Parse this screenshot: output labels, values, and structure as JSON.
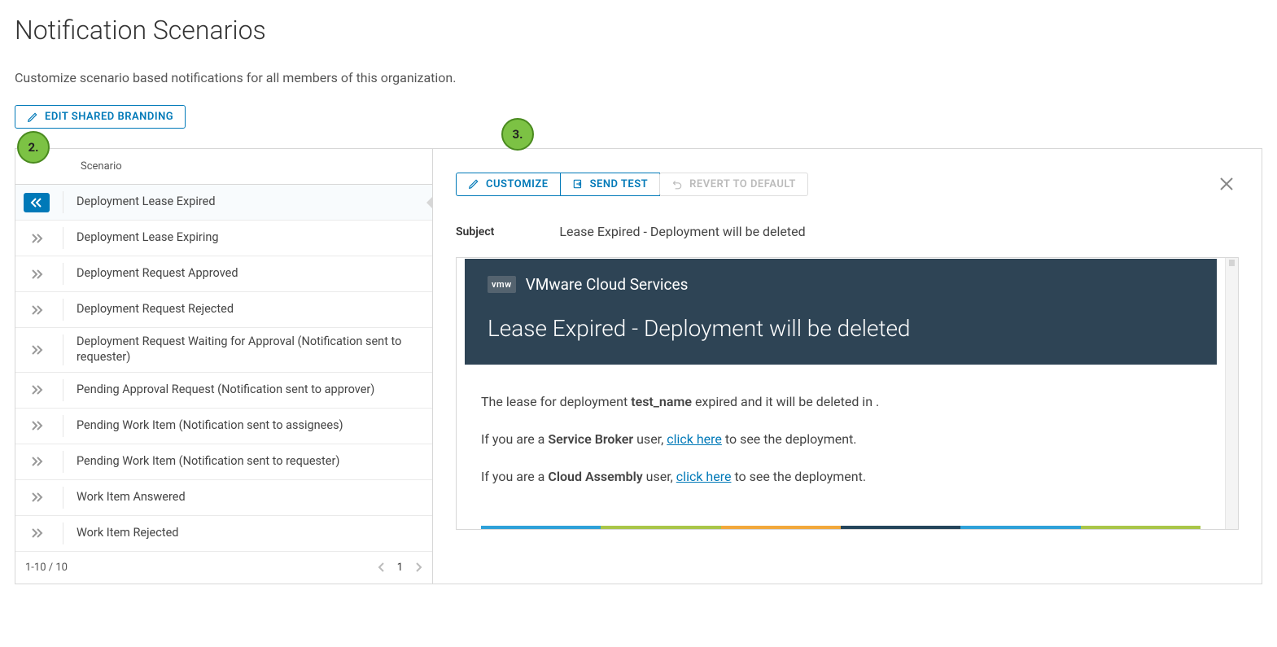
{
  "page": {
    "title": "Notification Scenarios",
    "subtitle": "Customize scenario based notifications for all members of this organization.",
    "edit_branding": "EDIT SHARED BRANDING"
  },
  "callouts": {
    "c2": "2.",
    "c3": "3."
  },
  "scenario_header": "Scenario",
  "scenarios": [
    {
      "label": "Deployment Lease Expired",
      "selected": true
    },
    {
      "label": "Deployment Lease Expiring"
    },
    {
      "label": "Deployment Request Approved"
    },
    {
      "label": "Deployment Request Rejected"
    },
    {
      "label": "Deployment Request Waiting for Approval (Notification sent to requester)"
    },
    {
      "label": "Pending Approval Request (Notification sent to approver)"
    },
    {
      "label": "Pending Work Item (Notification sent to assignees)"
    },
    {
      "label": "Pending Work Item (Notification sent to requester)"
    },
    {
      "label": "Work Item Answered"
    },
    {
      "label": "Work Item Rejected"
    }
  ],
  "pagination": {
    "range": "1-10 / 10",
    "page": "1"
  },
  "detail": {
    "customize": "CUSTOMIZE",
    "send_test": "SEND TEST",
    "revert": "REVERT TO DEFAULT",
    "subject_label": "Subject",
    "subject_value": "Lease Expired - Deployment will be deleted",
    "brand_badge": "vmw",
    "brand_name": "VMware Cloud Services",
    "preview_title": "Lease Expired - Deployment will be deleted",
    "body": {
      "p1a": "The lease for deployment ",
      "p1b": "test_name",
      "p1c": " expired and it will be deleted in .",
      "p2a": "If you are a ",
      "p2b": "Service Broker",
      "p2c": " user, ",
      "p2link": "click here",
      "p2d": " to see the deployment.",
      "p3a": "If you are a ",
      "p3b": "Cloud Assembly",
      "p3c": " user, ",
      "p3link": "click here",
      "p3d": " to see the deployment."
    },
    "strip_colors": [
      "#2ea1d9",
      "#a9c648",
      "#f2a83b",
      "#24455b",
      "#2ea1d9",
      "#a9c648"
    ]
  }
}
